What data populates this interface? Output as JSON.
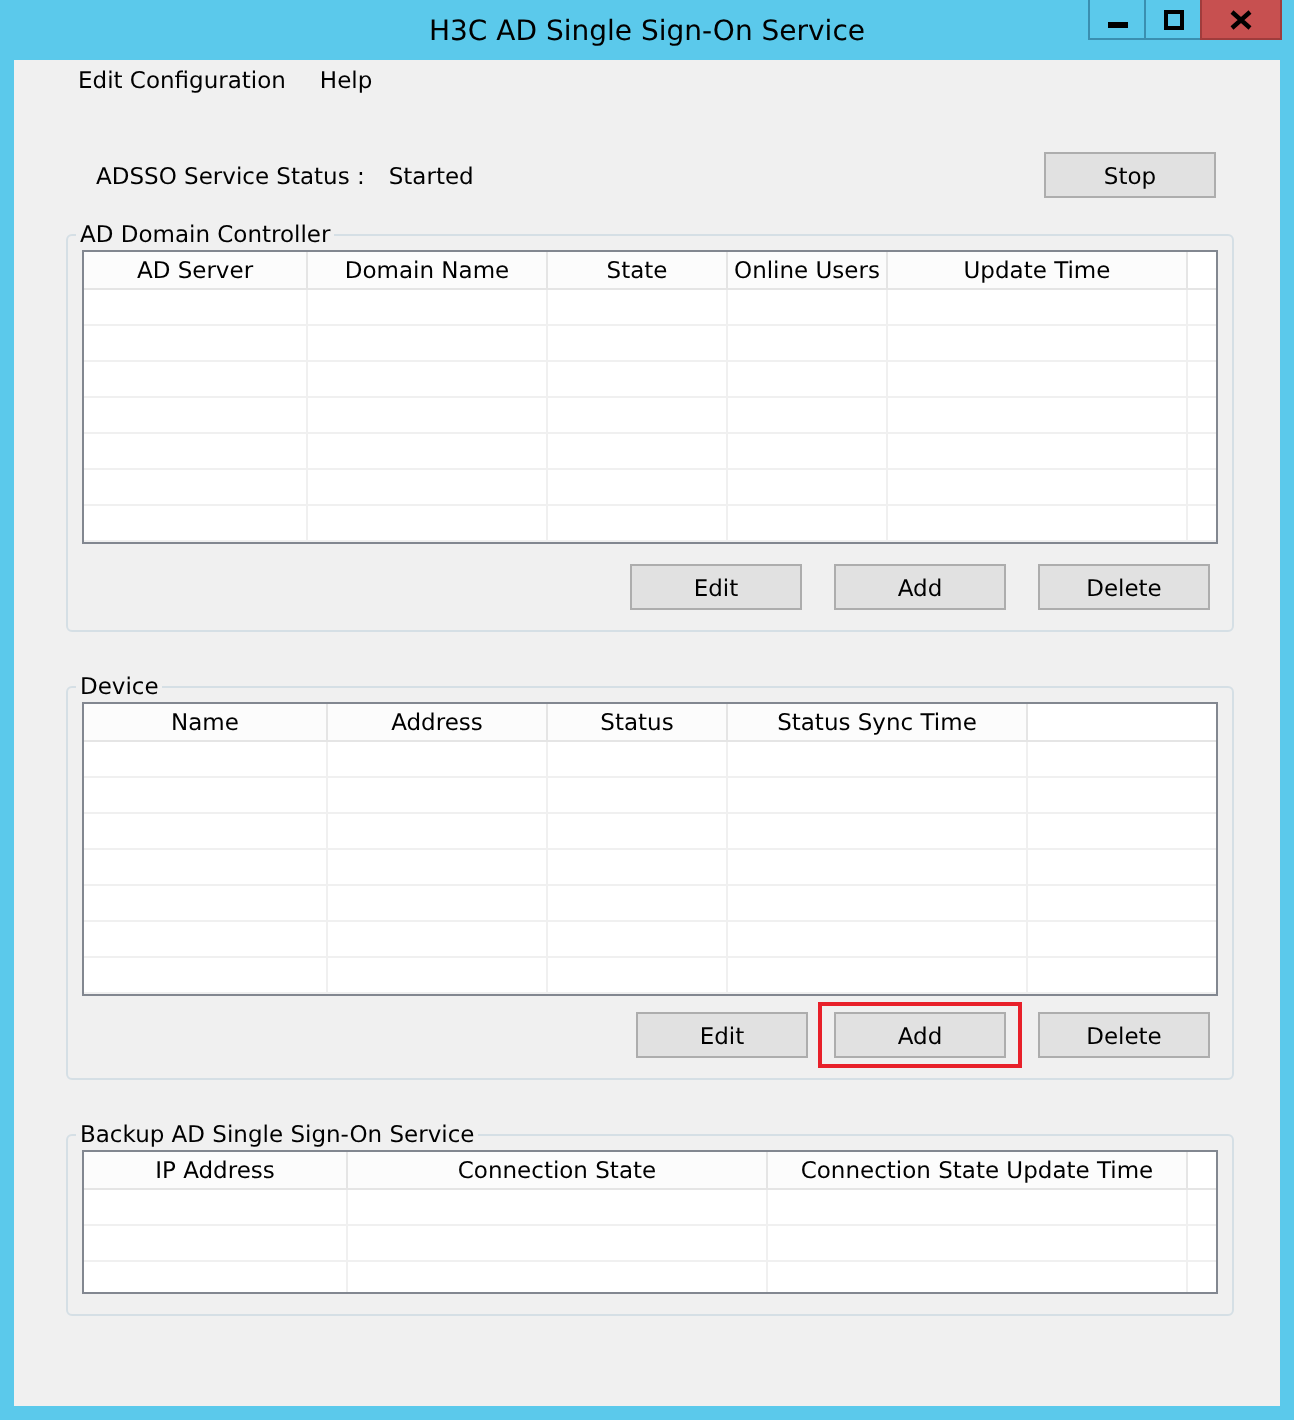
{
  "window": {
    "title": "H3C AD Single Sign-On Service"
  },
  "menu": [
    "Edit Configuration",
    "Help"
  ],
  "service_status": {
    "label": "ADSSO Service Status :",
    "value": "Started",
    "button": "Stop"
  },
  "groups": [
    {
      "title": "AD Domain Controller",
      "columns": [
        "AD Server",
        "Domain Name",
        "State",
        "Online Users",
        "Update Time"
      ],
      "buttons": [
        {
          "label": "Edit",
          "highlighted": false
        },
        {
          "label": "Add",
          "highlighted": false
        },
        {
          "label": "Delete",
          "highlighted": false
        }
      ]
    },
    {
      "title": "Device",
      "columns": [
        "Name",
        "Address",
        "Status",
        "Status Sync Time"
      ],
      "buttons": [
        {
          "label": "Edit",
          "highlighted": false
        },
        {
          "label": "Add",
          "highlighted": true
        },
        {
          "label": "Delete",
          "highlighted": false
        }
      ]
    },
    {
      "title": "Backup AD Single Sign-On Service",
      "columns": [
        "IP Address",
        "Connection State",
        "Connection State Update Time"
      ]
    }
  ]
}
